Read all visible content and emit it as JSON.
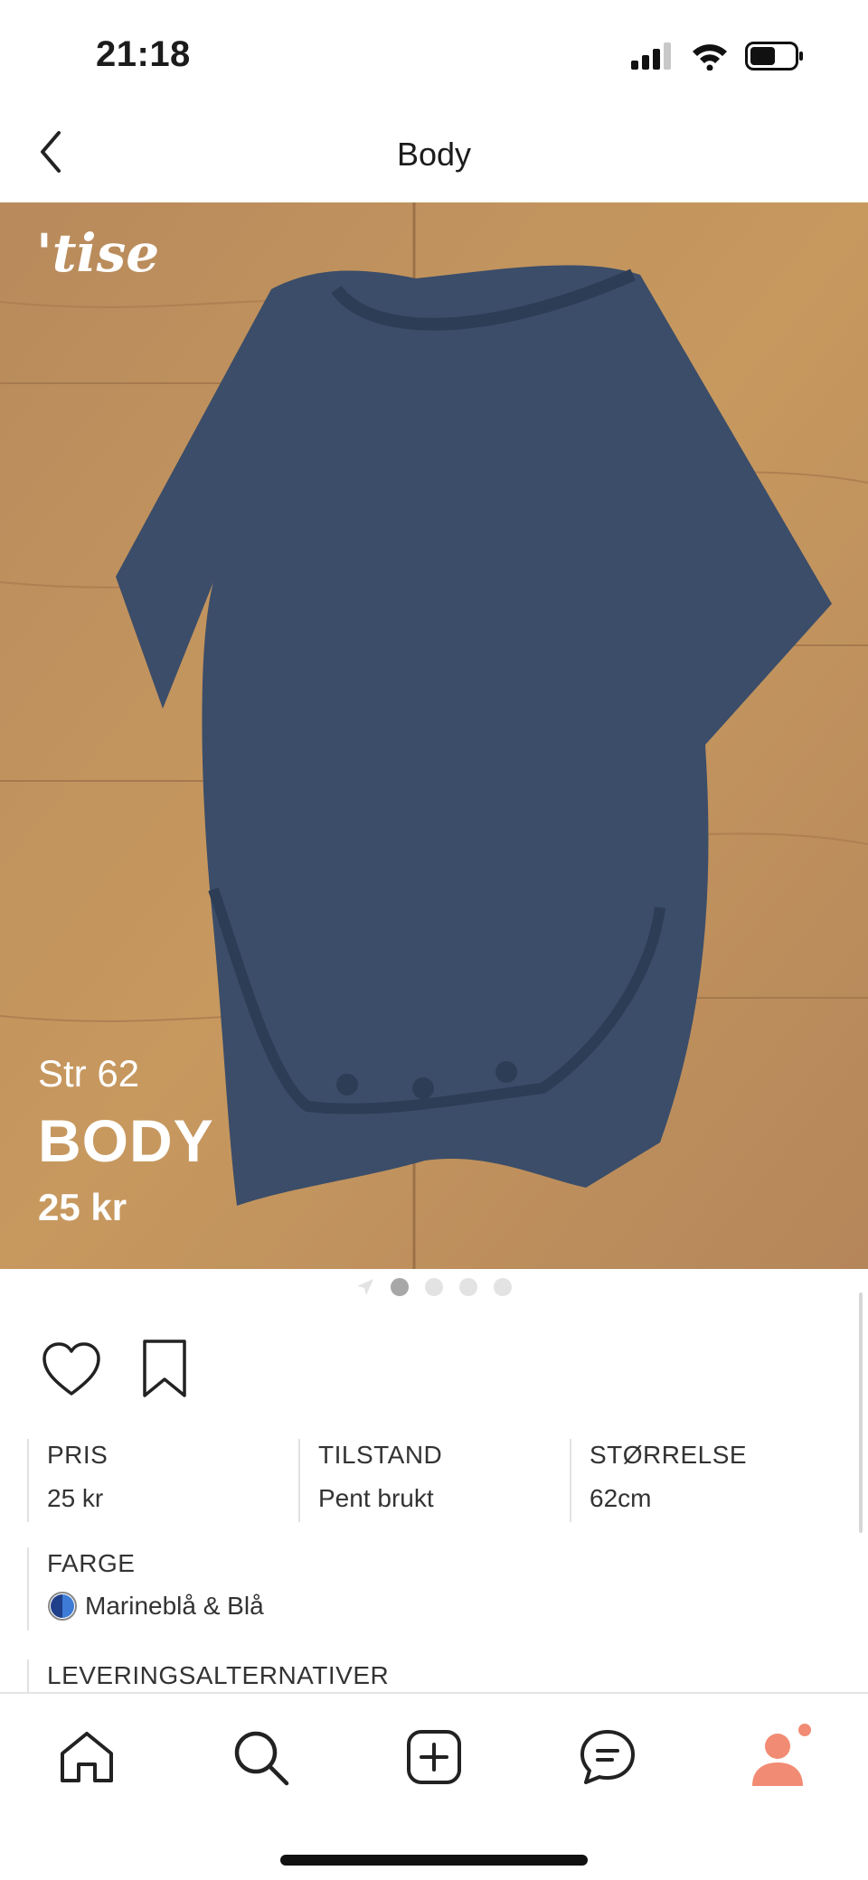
{
  "status_bar": {
    "time": "21:18"
  },
  "nav": {
    "title": "Body"
  },
  "photo": {
    "logo_text": "'tise",
    "size_text": "Str 62",
    "title_text": "BODY",
    "price_text": "25 kr",
    "carousel_count": 4,
    "carousel_active_index": 1
  },
  "details": {
    "price": {
      "label": "PRIS",
      "value": "25 kr"
    },
    "condition": {
      "label": "TILSTAND",
      "value": "Pent brukt"
    },
    "size": {
      "label": "STØRRELSE",
      "value": "62cm"
    },
    "color": {
      "label": "FARGE",
      "value": "Marineblå & Blå"
    },
    "delivery": {
      "label": "LEVERINGSALTERNATIVER"
    }
  },
  "tab_bar": {
    "items": [
      {
        "icon": "home-icon"
      },
      {
        "icon": "search-icon"
      },
      {
        "icon": "add-icon"
      },
      {
        "icon": "chat-icon"
      },
      {
        "icon": "profile-icon"
      }
    ]
  },
  "colors": {
    "accent": "#f28b73",
    "navy": "#1f3f8a",
    "garment": "#3b4d69"
  }
}
